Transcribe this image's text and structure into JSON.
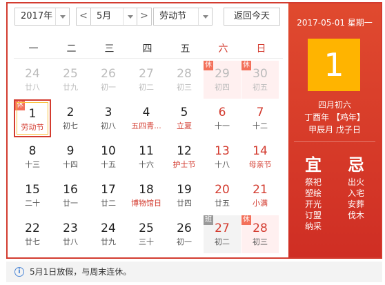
{
  "toolbar": {
    "year_value": "2017年",
    "prev_month": "<",
    "month_value": "5月",
    "next_month": ">",
    "holiday_value": "劳动节",
    "today_button": "返回今天"
  },
  "weekdays": [
    "一",
    "二",
    "三",
    "四",
    "五",
    "六",
    "日"
  ],
  "weeks": [
    [
      {
        "day": "24",
        "lunar": "廿八",
        "other": true
      },
      {
        "day": "25",
        "lunar": "廿九",
        "other": true
      },
      {
        "day": "26",
        "lunar": "初一",
        "other": true
      },
      {
        "day": "27",
        "lunar": "初二",
        "other": true
      },
      {
        "day": "28",
        "lunar": "初三",
        "other": true
      },
      {
        "day": "29",
        "lunar": "初四",
        "other": true,
        "tag": "休"
      },
      {
        "day": "30",
        "lunar": "初五",
        "other": true,
        "tag": "休"
      }
    ],
    [
      {
        "day": "1",
        "lunar": "劳动节",
        "tag": "休",
        "today": true,
        "festival": true
      },
      {
        "day": "2",
        "lunar": "初七"
      },
      {
        "day": "3",
        "lunar": "初八"
      },
      {
        "day": "4",
        "lunar": "五四青...",
        "festival": true
      },
      {
        "day": "5",
        "lunar": "立夏",
        "festival": true
      },
      {
        "day": "6",
        "lunar": "十一"
      },
      {
        "day": "7",
        "lunar": "十二"
      }
    ],
    [
      {
        "day": "8",
        "lunar": "十三"
      },
      {
        "day": "9",
        "lunar": "十四"
      },
      {
        "day": "10",
        "lunar": "十五"
      },
      {
        "day": "11",
        "lunar": "十六"
      },
      {
        "day": "12",
        "lunar": "护士节",
        "festival": true
      },
      {
        "day": "13",
        "lunar": "十八"
      },
      {
        "day": "14",
        "lunar": "母亲节",
        "festival": true
      }
    ],
    [
      {
        "day": "15",
        "lunar": "二十"
      },
      {
        "day": "16",
        "lunar": "廿一"
      },
      {
        "day": "17",
        "lunar": "廿二"
      },
      {
        "day": "18",
        "lunar": "博物馆日",
        "festival": true
      },
      {
        "day": "19",
        "lunar": "廿四"
      },
      {
        "day": "20",
        "lunar": "廿五"
      },
      {
        "day": "21",
        "lunar": "小满",
        "festival": true
      }
    ],
    [
      {
        "day": "22",
        "lunar": "廿七"
      },
      {
        "day": "23",
        "lunar": "廿八"
      },
      {
        "day": "24",
        "lunar": "廿九"
      },
      {
        "day": "25",
        "lunar": "三十"
      },
      {
        "day": "26",
        "lunar": "初一"
      },
      {
        "day": "27",
        "lunar": "初二",
        "tag": "班"
      },
      {
        "day": "28",
        "lunar": "初三",
        "tag": "休"
      }
    ]
  ],
  "side": {
    "date_line": "2017-05-01 星期一",
    "big_day": "1",
    "lunar_date": "四月初六",
    "ganzhi_year": "丁酉年 【鸡年】",
    "ganzhi_month_day": "甲辰月 戊子日",
    "yi_label": "宜",
    "ji_label": "忌",
    "yi_items": [
      "祭祀",
      "塑绘",
      "开光",
      "订盟",
      "纳采"
    ],
    "ji_items": [
      "出火",
      "入宅",
      "安葬",
      "伐木"
    ]
  },
  "footer": {
    "info_icon": "i",
    "message": "5月1日放假，与周末连休。"
  }
}
